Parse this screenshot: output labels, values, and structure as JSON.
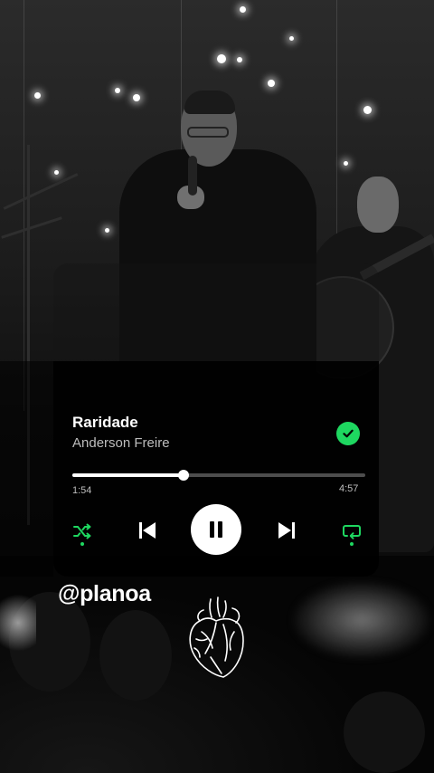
{
  "player": {
    "title": "Raridade",
    "artist": "Anderson Freire",
    "elapsed": "1:54",
    "total": "4:57",
    "progress": 0.38,
    "liked": true,
    "liked_icon": "check-circle-icon",
    "controls": {
      "shuffle_icon": "shuffle-icon",
      "prev_icon": "skip-previous-icon",
      "play_icon": "pause-icon",
      "next_icon": "skip-next-icon",
      "repeat_icon": "repeat-icon"
    },
    "accent_color": "#1ed760"
  },
  "overlay": {
    "handle": "@planoa",
    "sticker_icon": "anatomical-heart-icon"
  }
}
